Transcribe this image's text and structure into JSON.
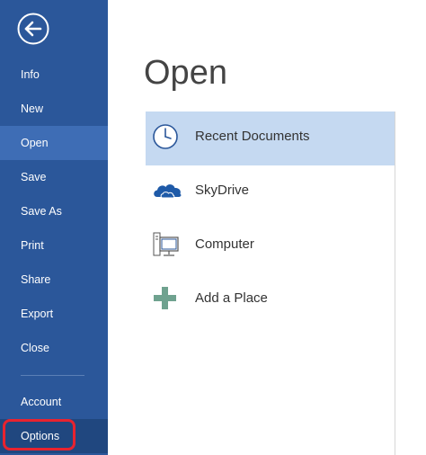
{
  "sidebar": {
    "back_icon": "back-arrow-icon",
    "items": [
      {
        "label": "Info"
      },
      {
        "label": "New"
      },
      {
        "label": "Open"
      },
      {
        "label": "Save"
      },
      {
        "label": "Save As"
      },
      {
        "label": "Print"
      },
      {
        "label": "Share"
      },
      {
        "label": "Export"
      },
      {
        "label": "Close"
      },
      {
        "label": "Account"
      },
      {
        "label": "Options"
      }
    ],
    "active_item": "Open",
    "highlighted_item": "Options",
    "background_color": "#2b579a",
    "active_color": "#3e6db5",
    "highlight_ring_color": "#e8232f"
  },
  "main": {
    "title": "Open",
    "places": [
      {
        "label": "Recent Documents",
        "icon": "clock-icon",
        "selected": true
      },
      {
        "label": "SkyDrive",
        "icon": "cloud-icon",
        "selected": false
      },
      {
        "label": "Computer",
        "icon": "computer-icon",
        "selected": false
      },
      {
        "label": "Add a Place",
        "icon": "plus-icon",
        "selected": false
      }
    ],
    "selected_color": "#c5d9f1"
  }
}
